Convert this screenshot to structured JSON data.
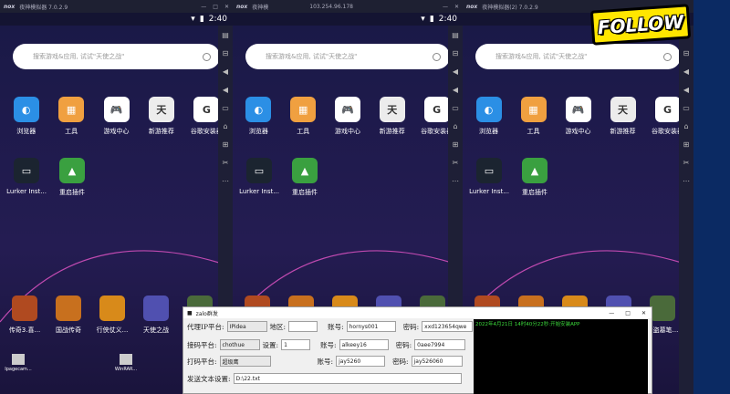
{
  "emulators": [
    {
      "title": "夜神模拟器 7.0.2.9",
      "show_sidebar": true
    },
    {
      "title": "夜神模",
      "show_sidebar": true
    },
    {
      "title": "夜神模拟器(2) 7.0.2.9",
      "show_sidebar": true
    }
  ],
  "ip_label": "103.254.96.178",
  "status": {
    "time": "2:40"
  },
  "search_placeholder": "搜索游戏&应用, 试试\"天使之战\"",
  "apps_row1": [
    {
      "label": "浏览器",
      "color": "#2b8fe5",
      "glyph": "◐"
    },
    {
      "label": "工具",
      "color": "#f0a040",
      "glyph": "▦"
    },
    {
      "label": "游戏中心",
      "color": "#ffffff",
      "glyph": "🎮"
    },
    {
      "label": "新游推荐",
      "color": "#ececec",
      "glyph": "天"
    },
    {
      "label": "谷歌安装器",
      "color": "#ffffff",
      "glyph": "G"
    }
  ],
  "apps_row2": [
    {
      "label": "Lurker Inst...",
      "color": "#1b2430",
      "glyph": "▭"
    },
    {
      "label": "重启插件",
      "color": "#3aa040",
      "glyph": "▲"
    }
  ],
  "dock_apps": [
    {
      "label": "传奇3.喜...",
      "color": "#b04a20"
    },
    {
      "label": "国战传奇",
      "color": "#c8701e"
    },
    {
      "label": "行侠仗义...",
      "color": "#d88a1a"
    },
    {
      "label": "天使之战",
      "color": "#5050b0"
    },
    {
      "label": "新盗墓笔...",
      "color": "#4a6a3a"
    },
    {
      "label": "",
      "color": "#888888"
    }
  ],
  "dialog": {
    "title": "zalo群发",
    "proxy_label": "代理IP平台:",
    "proxy_value": "IPidea",
    "region_label": "地区:",
    "region_value": "",
    "code_label": "接码平台:",
    "code_value": "chothue",
    "qty_label": "设置:",
    "qty_value": "1",
    "captcha_label": "打码平台:",
    "captcha_value": "超级鹰",
    "send_label": "发送文本设置:",
    "send_value": "D:\\22.txt",
    "acc_label": "账号:",
    "pwd_label": "密码:",
    "accounts": [
      {
        "user": "hornys001",
        "pass": "xxd123654qwe"
      },
      {
        "user": "alkeey16",
        "pass": "0aee7994"
      },
      {
        "user": "jay5260",
        "pass": "jay526060"
      }
    ],
    "log_line": "2022年4月21日 14时40分22秒:开始安装APP"
  },
  "follow_text": "FOLLOW",
  "desktop_icons": [
    "Ipagecam...",
    "WinRAR..."
  ]
}
